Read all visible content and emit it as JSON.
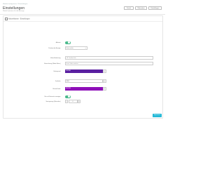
{
  "breadcrumb": "Module konfigurieren  /  Einstellungen",
  "header": {
    "title": "Einstellungen",
    "subtitle": "Modul-Optionen für die Anzeige",
    "buttons": [
      "Zurück",
      "Übersetzen",
      "Einstellungen"
    ]
  },
  "panel": {
    "heading": "Videoreklamen - Einstellungen",
    "save_label": "Speichern"
  },
  "form": {
    "enabled": {
      "label": "Aktiviert",
      "toggle_text": "Ja"
    },
    "display_position": {
      "label": "Position der Anzeige",
      "value": "Unten rechts"
    },
    "video_url": {
      "label": "Video-Einbettung",
      "value": "z.B. Youtube-Link"
    },
    "video_title": {
      "label": "Bezeichnung (Slider-Reiter)",
      "value": "Unser Video ansehen"
    },
    "background_color": {
      "label": "Hintergrund",
      "value": "#5A1FA0",
      "color": "#5a1fa0"
    },
    "text_color": {
      "label": "Textfarbe",
      "value": "#FFF"
    },
    "button_color": {
      "label": "Button-Farbe",
      "value": "#8E0FB8",
      "color": "#8e0fb8"
    },
    "only_on_homepage": {
      "label": "Nur auf Startseite anzeigen",
      "toggle_text": "Ja"
    },
    "delay": {
      "label": "Verzögerung (Sekunden)",
      "value": "0",
      "minus": "−",
      "plus": "+"
    }
  },
  "icons": {
    "panel_heading": "settings-icon",
    "color_picker": "color-picker-icon",
    "select_caret": "chevron-down-icon"
  },
  "colors": {
    "accent": "#25b9d7",
    "toggle_on": "#4cba8d",
    "swatch_background": "#5a1fa0",
    "swatch_button": "#8e0fb8"
  }
}
